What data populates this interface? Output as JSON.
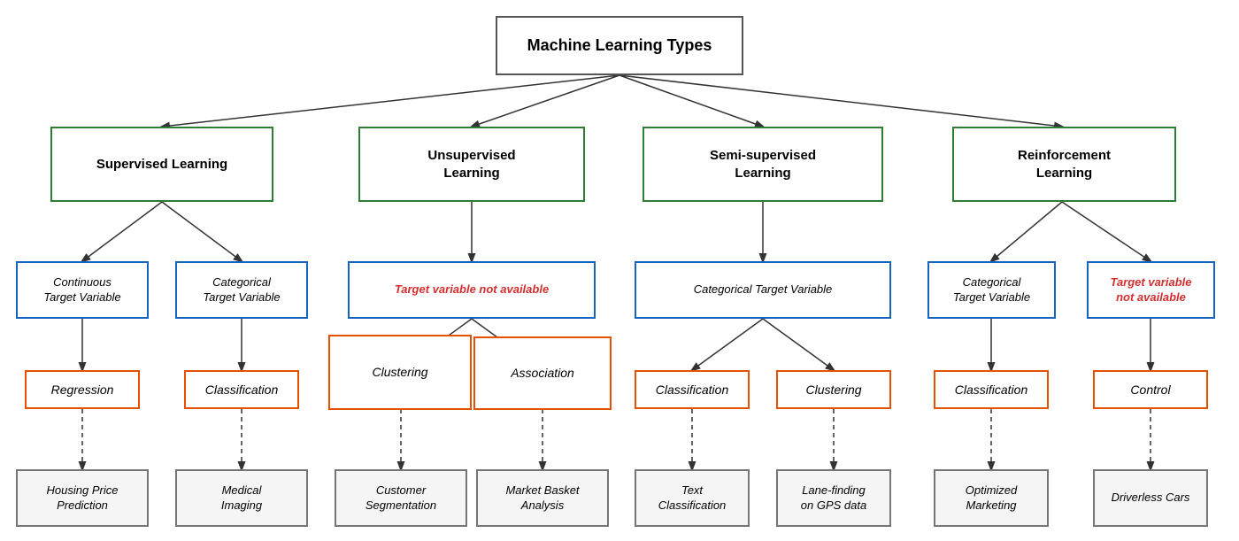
{
  "title": "Machine Learning Types",
  "nodes": {
    "root": {
      "label": "Machine Learning Types"
    },
    "supervised": {
      "label": "Supervised Learning"
    },
    "unsupervised": {
      "label": "Unsupervised\nLearning"
    },
    "semi": {
      "label": "Semi-supervised\nLearning"
    },
    "reinforcement": {
      "label": "Reinforcement\nLearning"
    },
    "continuous": {
      "label": "Continuous\nTarget Variable"
    },
    "categorical_sup": {
      "label": "Categorical\nTarget Variable"
    },
    "target_not_avail_unsup": {
      "label": "Target variable not available"
    },
    "categorical_semi": {
      "label": "Categorical Target Variable"
    },
    "categorical_reinf": {
      "label": "Categorical\nTarget Variable"
    },
    "target_not_avail_reinf": {
      "label": "Target variable\nnot available"
    },
    "regression": {
      "label": "Regression"
    },
    "classification_sup": {
      "label": "Classification"
    },
    "clustering_unsup": {
      "label": "Clustering"
    },
    "association": {
      "label": "Association"
    },
    "classification_semi": {
      "label": "Classification"
    },
    "clustering_semi": {
      "label": "Clustering"
    },
    "classification_reinf": {
      "label": "Classification"
    },
    "control": {
      "label": "Control"
    },
    "housing": {
      "label": "Housing Price\nPrediction"
    },
    "medical": {
      "label": "Medical\nImaging"
    },
    "customer": {
      "label": "Customer\nSegmentation"
    },
    "market": {
      "label": "Market Basket\nAnalysis"
    },
    "text_class": {
      "label": "Text\nClassification"
    },
    "lane": {
      "label": "Lane-finding\non GPS data"
    },
    "optimized": {
      "label": "Optimized\nMarketing"
    },
    "driverless": {
      "label": "Driverless Cars"
    }
  }
}
